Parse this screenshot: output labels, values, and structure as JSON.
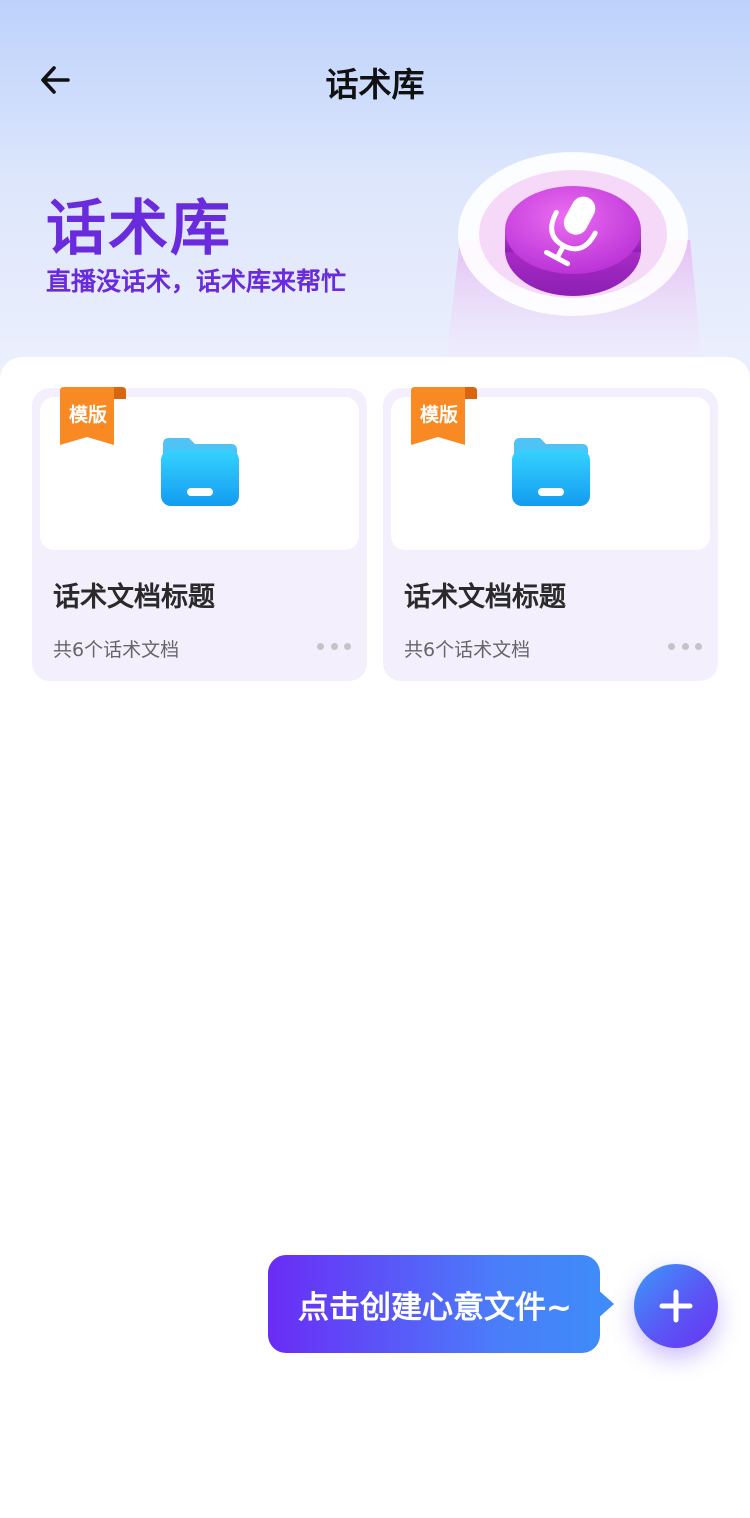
{
  "header": {
    "title": "话术库",
    "back_icon": "arrow-left-icon"
  },
  "hero": {
    "title": "话术库",
    "subtitle": "直播没话术，话术库来帮忙",
    "illustration_icon": "microphone-icon"
  },
  "cards": [
    {
      "badge": "模版",
      "title": "话术文档标题",
      "count_text": "共6个话术文档",
      "icon": "folder-icon"
    },
    {
      "badge": "模版",
      "title": "话术文档标题",
      "count_text": "共6个话术文档",
      "icon": "folder-icon"
    }
  ],
  "tooltip": {
    "text": "点击创建心意文件~"
  },
  "fab": {
    "icon": "plus-icon"
  },
  "colors": {
    "accent_purple": "#6a2bdc",
    "badge_orange": "#f98a23",
    "fab_gradient_start": "#3c9afa",
    "fab_gradient_end": "#6a34f2",
    "folder_blue": "#1fb7f7"
  }
}
